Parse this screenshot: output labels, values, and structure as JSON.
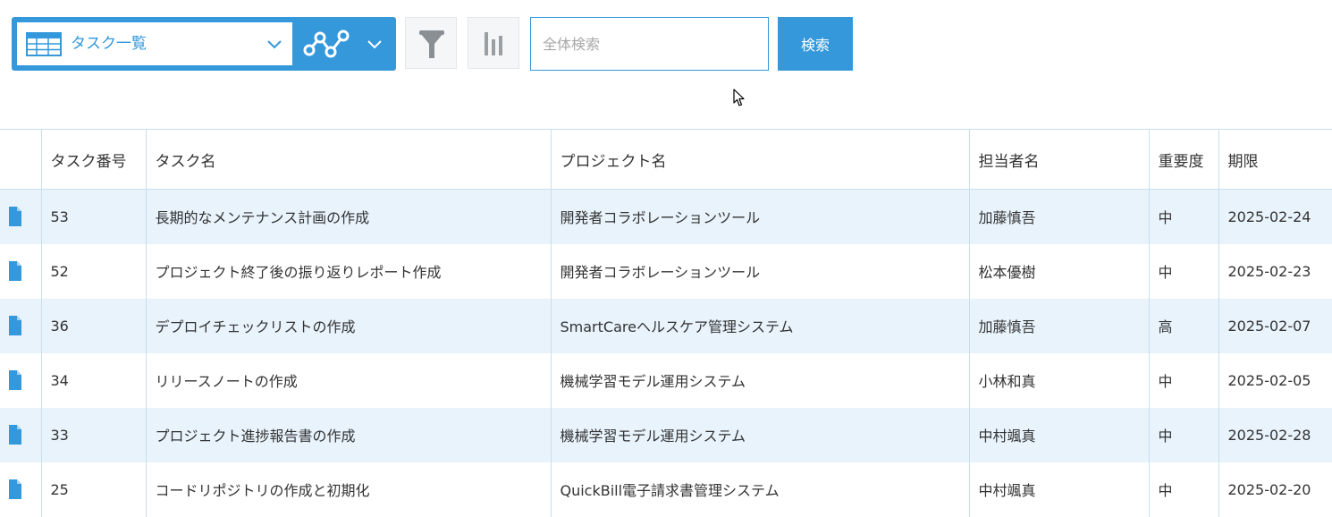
{
  "toolbar": {
    "view_label": "タスク一覧",
    "search_placeholder": "全体検索",
    "search_value": "",
    "search_button": "検索",
    "icons": {
      "view": "list-table-icon",
      "graph": "line-graph-icon",
      "filter": "filter-funnel-icon",
      "chart": "bar-chart-icon"
    },
    "accent_color": "#3498db"
  },
  "table": {
    "headers": {
      "task_no": "タスク番号",
      "task_name": "タスク名",
      "project": "プロジェクト名",
      "assignee": "担当者名",
      "priority": "重要度",
      "due": "期限"
    },
    "rows": [
      {
        "task_no": "53",
        "task_name": "長期的なメンテナンス計画の作成",
        "project": "開発者コラボレーションツール",
        "assignee": "加藤慎吾",
        "priority": "中",
        "due": "2025-02-24"
      },
      {
        "task_no": "52",
        "task_name": "プロジェクト終了後の振り返りレポート作成",
        "project": "開発者コラボレーションツール",
        "assignee": "松本優樹",
        "priority": "中",
        "due": "2025-02-23"
      },
      {
        "task_no": "36",
        "task_name": "デプロイチェックリストの作成",
        "project": "SmartCareヘルスケア管理システム",
        "assignee": "加藤慎吾",
        "priority": "高",
        "due": "2025-02-07"
      },
      {
        "task_no": "34",
        "task_name": "リリースノートの作成",
        "project": "機械学習モデル運用システム",
        "assignee": "小林和真",
        "priority": "中",
        "due": "2025-02-05"
      },
      {
        "task_no": "33",
        "task_name": "プロジェクト進捗報告書の作成",
        "project": "機械学習モデル運用システム",
        "assignee": "中村颯真",
        "priority": "中",
        "due": "2025-02-28"
      },
      {
        "task_no": "25",
        "task_name": "コードリポジトリの作成と初期化",
        "project": "QuickBill電子請求書管理システム",
        "assignee": "中村颯真",
        "priority": "中",
        "due": "2025-02-20"
      }
    ]
  }
}
